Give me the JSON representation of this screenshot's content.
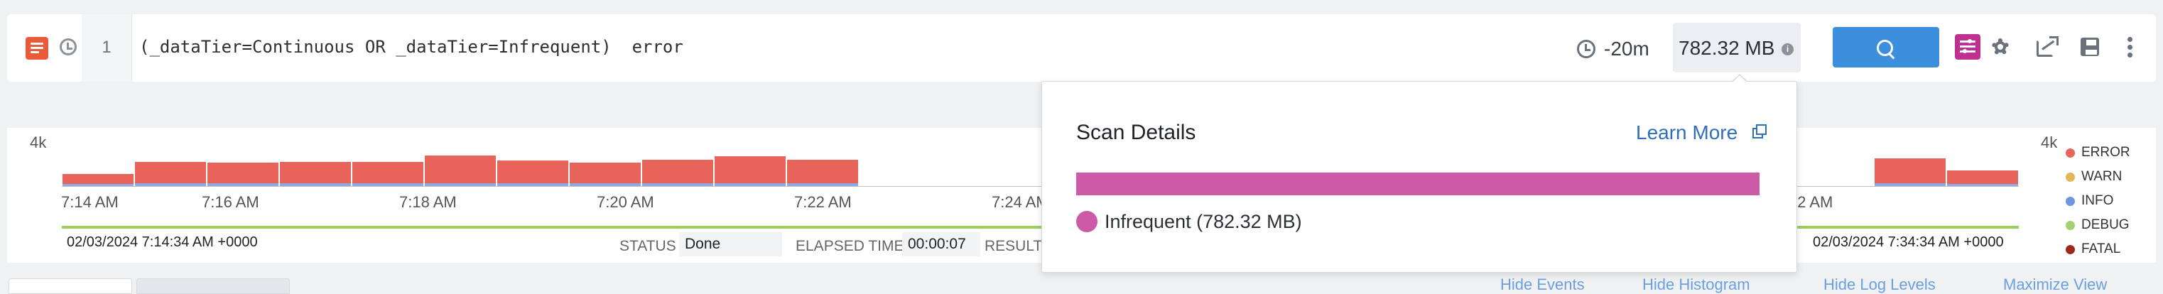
{
  "query": {
    "line_number": "1",
    "text": "(_dataTier=Continuous OR _dataTier=Infrequent)  error",
    "time_range": "-20m",
    "scan_size": "782.32 MB",
    "info_glyph": "i",
    "icons": [
      "list-icon",
      "clock-icon",
      "search-icon",
      "filter-icon",
      "gear-icon",
      "share-icon",
      "save-icon",
      "more-icon"
    ]
  },
  "histogram": {
    "y_max_label": "4k",
    "time_labels": [
      "7:14 AM",
      "7:16 AM",
      "7:18 AM",
      "7:20 AM",
      "7:22 AM",
      "7:24 AM",
      "32 AM"
    ],
    "start_timestamp": "02/03/2024 7:14:34 AM +0000",
    "end_timestamp": "02/03/2024 7:34:34 AM +0000",
    "status_label": "STATUS",
    "status_value": "Done",
    "elapsed_label": "ELAPSED TIME",
    "elapsed_value": "00:00:07",
    "result_label": "RESULT",
    "legend": [
      {
        "label": "ERROR",
        "color": "#e8645a"
      },
      {
        "label": "WARN",
        "color": "#e0b85a"
      },
      {
        "label": "INFO",
        "color": "#6f96e0"
      },
      {
        "label": "DEBUG",
        "color": "#a6d070"
      },
      {
        "label": "FATAL",
        "color": "#9e2a1e"
      }
    ]
  },
  "chart_data": {
    "type": "bar",
    "stacked": true,
    "y_tick_labels": [
      "4k"
    ],
    "series": [
      {
        "name": "ERROR",
        "color": "#e8645a",
        "values": [
          0.95,
          1.95,
          1.9,
          2.0,
          2.0,
          2.6,
          2.1,
          1.9,
          2.2,
          2.5,
          2.2,
          0,
          0,
          0,
          0,
          0,
          0,
          0,
          0,
          0,
          0,
          0,
          0,
          0,
          0,
          2.3,
          1.3
        ]
      },
      {
        "name": "INFO",
        "color": "#8fa9e0",
        "values": [
          0.2,
          0.3,
          0.3,
          0.3,
          0.3,
          0.3,
          0.3,
          0.3,
          0.3,
          0.3,
          0.3,
          0,
          0,
          0,
          0,
          0,
          0,
          0,
          0,
          0,
          0,
          0,
          0,
          0,
          0,
          0.3,
          0.2
        ]
      }
    ]
  },
  "bottom_links": [
    "Hide Events",
    "Hide Histogram",
    "Hide Log Levels",
    "Maximize View"
  ],
  "scan_details": {
    "title": "Scan Details",
    "learn_more": "Learn More",
    "tier_color": "#cc5aa6",
    "tier_label": "Infrequent (782.32 MB)",
    "tier_fraction": 1.0
  }
}
